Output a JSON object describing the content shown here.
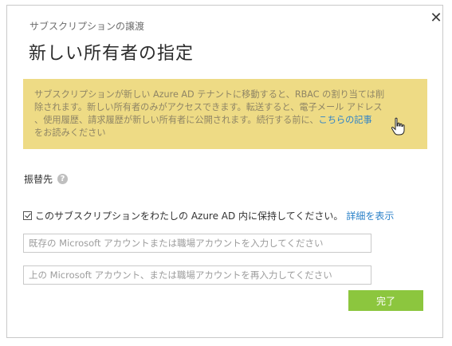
{
  "dialog": {
    "subtitle": "サブスクリプションの譲渡",
    "title": "新しい所有者の指定",
    "close_symbol": "✕"
  },
  "warning": {
    "line1": "サブスクリプションが新しい Azure AD テナントに移動すると、RBAC の割り当ては削",
    "line2": "除されます。新しい所有者のみがアクセスできます。転送すると、電子メール アドレス",
    "line3_prefix": "、使用履歴、請求履歴が新しい所有者に公開されます。続行する前に、",
    "link": "こちらの記事",
    "line4": "をお読みください",
    "background_color": "#eedb85"
  },
  "transfer_target": {
    "label": "振替先",
    "help_symbol": "?"
  },
  "keep_checkbox": {
    "checked": true,
    "label": "このサブスクリプションをわたしの Azure AD 内に保持してください。",
    "details_link": "詳細を表示"
  },
  "account_input": {
    "placeholder": "既存の Microsoft アカウントまたは職場アカウントを入力してください",
    "value": ""
  },
  "confirm_input": {
    "placeholder": "上の Microsoft アカウント、または職場アカウントを再入力してください",
    "value": ""
  },
  "done_button": {
    "label": "完了",
    "color": "#8cc63e"
  },
  "icons": {
    "close": "close-icon",
    "help": "help-icon",
    "cursor": "hand-cursor-icon",
    "checkbox": "checkbox-checked-icon"
  }
}
